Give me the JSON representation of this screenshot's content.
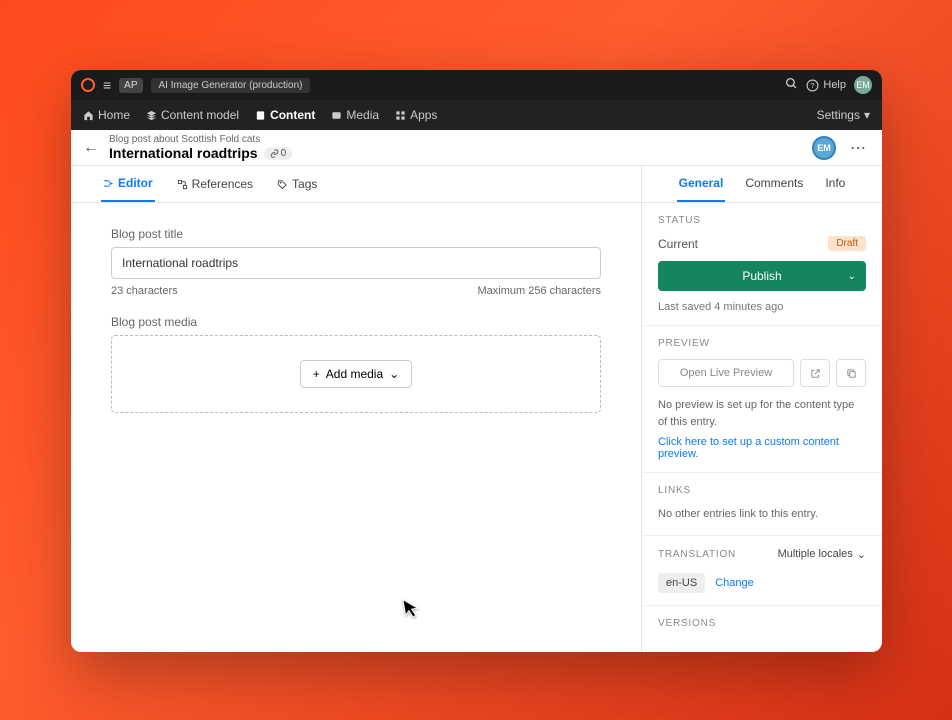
{
  "topbar": {
    "badge": "AP",
    "appname": "AI Image Generator (production)",
    "help_label": "Help",
    "avatar": "EM"
  },
  "navbar": {
    "items": [
      {
        "label": "Home"
      },
      {
        "label": "Content model"
      },
      {
        "label": "Content"
      },
      {
        "label": "Media"
      },
      {
        "label": "Apps"
      }
    ],
    "settings": "Settings"
  },
  "header": {
    "crumb": "Blog post about Scottish Fold cats",
    "title": "International roadtrips",
    "link_count": "0",
    "avatar": "EM"
  },
  "tabs": {
    "editor": "Editor",
    "references": "References",
    "tags": "Tags"
  },
  "form": {
    "title_label": "Blog post title",
    "title_value": "International roadtrips",
    "char_count": "23 characters",
    "char_max": "Maximum 256 characters",
    "media_label": "Blog post media",
    "add_media": "Add media"
  },
  "side_tabs": {
    "general": "General",
    "comments": "Comments",
    "info": "Info"
  },
  "status": {
    "heading": "Status",
    "current_label": "Current",
    "badge": "Draft",
    "publish": "Publish",
    "last_saved": "Last saved 4 minutes ago"
  },
  "preview": {
    "heading": "Preview",
    "open_live": "Open Live Preview",
    "no_preview": "No preview is set up for the content type of this entry.",
    "setup_link": "Click here to set up a custom content preview."
  },
  "links": {
    "heading": "Links",
    "text": "No other entries link to this entry."
  },
  "translation": {
    "heading": "Translation",
    "multiple": "Multiple locales",
    "locale": "en-US",
    "change": "Change"
  },
  "versions": {
    "heading": "Versions"
  }
}
